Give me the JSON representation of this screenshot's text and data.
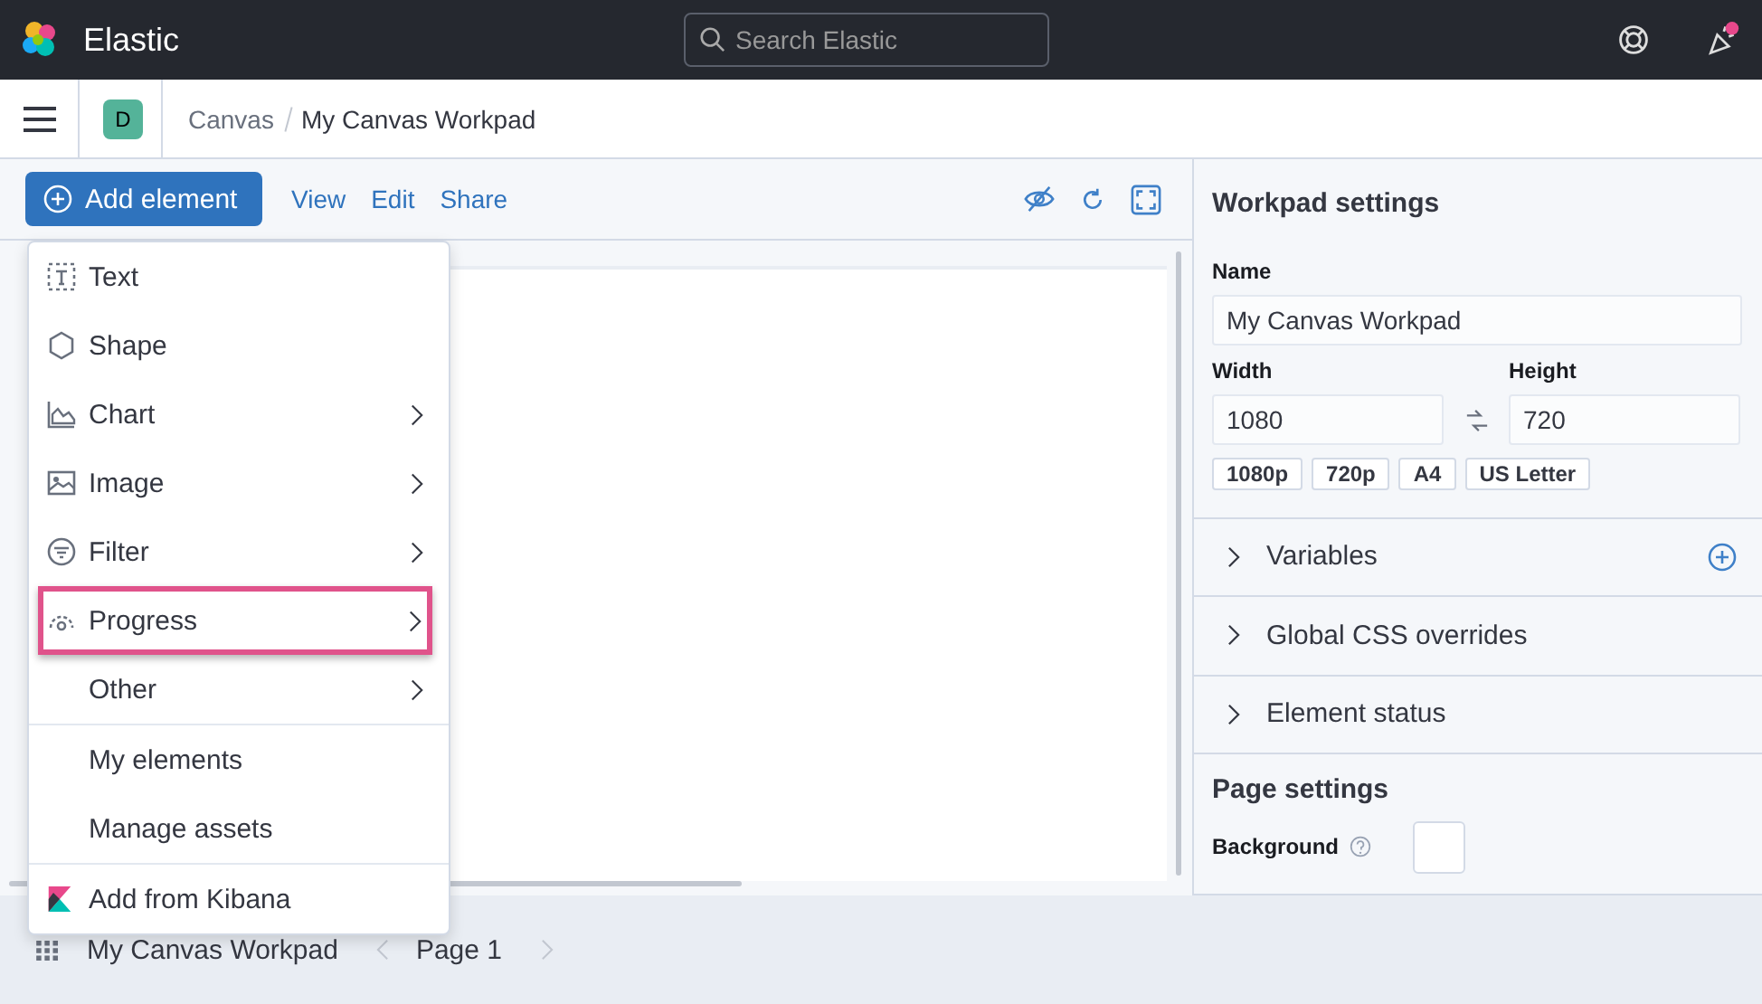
{
  "header": {
    "brand": "Elastic",
    "search": {
      "placeholder": "Search Elastic"
    },
    "notification": true
  },
  "breadcrumbs": {
    "avatar": "D",
    "items": [
      {
        "label": "Canvas"
      },
      {
        "label": "My Canvas Workpad"
      }
    ]
  },
  "toolbar": {
    "add_button": "Add element",
    "links": [
      "View",
      "Edit",
      "Share"
    ]
  },
  "menu": {
    "sections": [
      [
        {
          "label": "Text",
          "kind": "text",
          "submenu": false,
          "highlighted": false
        },
        {
          "label": "Shape",
          "kind": "shape",
          "submenu": false,
          "highlighted": false
        },
        {
          "label": "Chart",
          "kind": "chart",
          "submenu": true,
          "highlighted": false
        },
        {
          "label": "Image",
          "kind": "image",
          "submenu": true,
          "highlighted": false
        },
        {
          "label": "Filter",
          "kind": "filter",
          "submenu": true,
          "highlighted": false
        },
        {
          "label": "Progress",
          "kind": "progress",
          "submenu": true,
          "highlighted": true
        },
        {
          "label": "Other",
          "kind": "plain",
          "submenu": true,
          "highlighted": false
        }
      ],
      [
        {
          "label": "My elements",
          "kind": "plain",
          "submenu": false,
          "highlighted": false
        },
        {
          "label": "Manage assets",
          "kind": "plain",
          "submenu": false,
          "highlighted": false
        }
      ],
      [
        {
          "label": "Add from Kibana",
          "kind": "kibana",
          "submenu": false,
          "highlighted": false
        }
      ]
    ]
  },
  "settings": {
    "title": "Workpad settings",
    "name": {
      "label": "Name",
      "value": "My Canvas Workpad"
    },
    "width": {
      "label": "Width",
      "value": "1080"
    },
    "height": {
      "label": "Height",
      "value": "720"
    },
    "presets": [
      "1080p",
      "720p",
      "A4",
      "US Letter"
    ],
    "sections": [
      {
        "label": "Variables",
        "expanded": false,
        "add": true
      },
      {
        "label": "Global CSS overrides",
        "expanded": false,
        "add": false
      },
      {
        "label": "Element status",
        "expanded": false,
        "add": false
      }
    ],
    "page_title": "Page settings",
    "background_label": "Background"
  },
  "footer": {
    "workpad": "My Canvas Workpad",
    "page": "Page 1"
  }
}
